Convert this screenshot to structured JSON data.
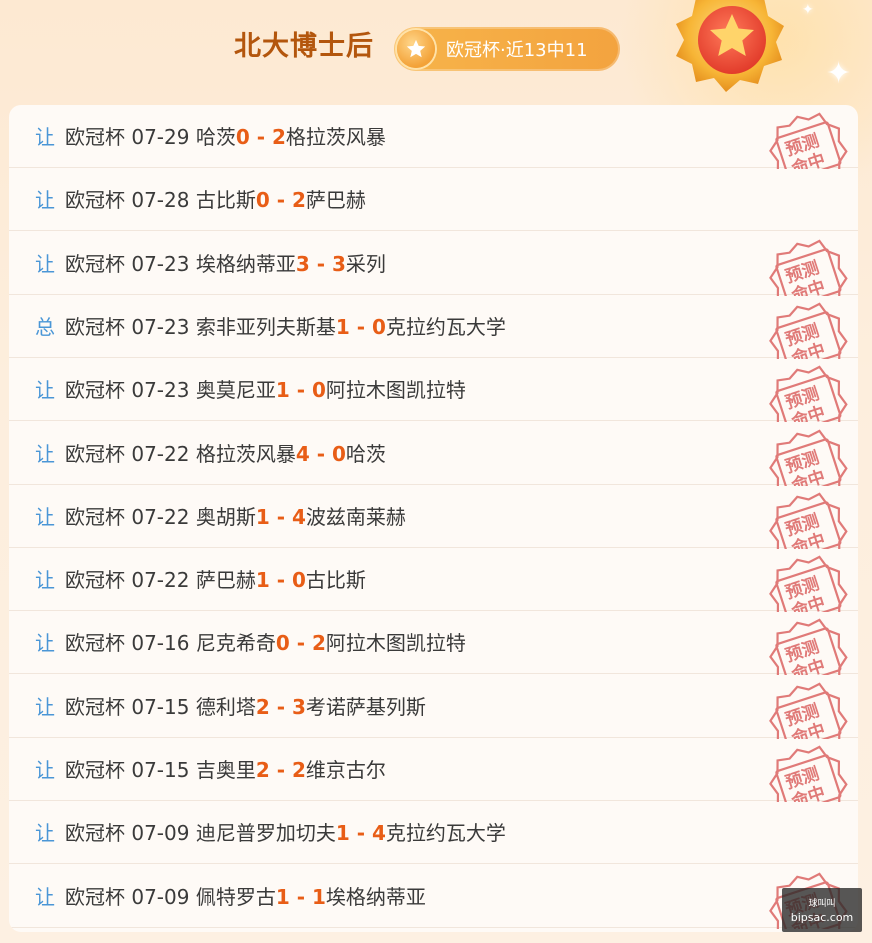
{
  "header": {
    "title": "北大博士后",
    "badge_text": "欧冠杯·近13中11"
  },
  "stamp_text": [
    "预测",
    "命中"
  ],
  "rows": [
    {
      "type": "让",
      "match": "欧冠杯 07-29 哈茨",
      "home_score": "0",
      "sep": " - ",
      "away_score": "2",
      "away": "格拉茨风暴",
      "hit": true
    },
    {
      "type": "让",
      "match": "欧冠杯 07-28 古比斯",
      "home_score": "0",
      "sep": " - ",
      "away_score": "2",
      "away": "萨巴赫",
      "hit": false
    },
    {
      "type": "让",
      "match": "欧冠杯 07-23 埃格纳蒂亚",
      "home_score": "3",
      "sep": " - ",
      "away_score": "3",
      "away": "采列",
      "hit": true
    },
    {
      "type": "总",
      "match": "欧冠杯 07-23 索非亚列夫斯基",
      "home_score": "1",
      "sep": " - ",
      "away_score": "0",
      "away": "克拉约瓦大学",
      "hit": true
    },
    {
      "type": "让",
      "match": "欧冠杯 07-23 奥莫尼亚",
      "home_score": "1",
      "sep": " - ",
      "away_score": "0",
      "away": "阿拉木图凯拉特",
      "hit": true
    },
    {
      "type": "让",
      "match": "欧冠杯 07-22 格拉茨风暴",
      "home_score": "4",
      "sep": " - ",
      "away_score": "0",
      "away": "哈茨",
      "hit": true
    },
    {
      "type": "让",
      "match": "欧冠杯 07-22 奥胡斯",
      "home_score": "1",
      "sep": " - ",
      "away_score": "4",
      "away": "波兹南莱赫",
      "hit": true
    },
    {
      "type": "让",
      "match": "欧冠杯 07-22 萨巴赫",
      "home_score": "1",
      "sep": " - ",
      "away_score": "0",
      "away": "古比斯",
      "hit": true
    },
    {
      "type": "让",
      "match": "欧冠杯 07-16 尼克希奇",
      "home_score": "0",
      "sep": " - ",
      "away_score": "2",
      "away": "阿拉木图凯拉特",
      "hit": true
    },
    {
      "type": "让",
      "match": "欧冠杯 07-15 德利塔",
      "home_score": "2",
      "sep": " - ",
      "away_score": "3",
      "away": "考诺萨基列斯",
      "hit": true
    },
    {
      "type": "让",
      "match": "欧冠杯 07-15 吉奥里",
      "home_score": "2",
      "sep": " - ",
      "away_score": "2",
      "away": "维京古尔",
      "hit": true
    },
    {
      "type": "让",
      "match": "欧冠杯 07-09 迪尼普罗加切夫",
      "home_score": "1",
      "sep": " - ",
      "away_score": "4",
      "away": "克拉约瓦大学",
      "hit": false
    },
    {
      "type": "让",
      "match": "欧冠杯 07-09 佩特罗古",
      "home_score": "1",
      "sep": " - ",
      "away_score": "1",
      "away": "埃格纳蒂亚",
      "hit": true
    }
  ],
  "watermark": {
    "top": "球叫叫",
    "bottom": "bipsac.com"
  },
  "colors": {
    "title": "#b3560d",
    "score": "#e85d16",
    "type": "#4a96d6",
    "stamp": "#e07a78",
    "badge": "#f3a33f"
  }
}
